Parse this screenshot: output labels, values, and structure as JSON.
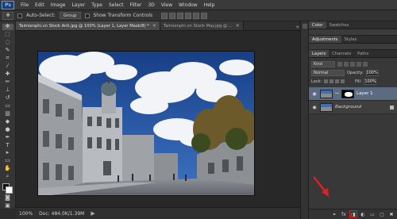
{
  "app": {
    "logo": "Ps"
  },
  "menu": [
    "File",
    "Edit",
    "Image",
    "Layer",
    "Type",
    "Select",
    "Filter",
    "3D",
    "View",
    "Window",
    "Help"
  ],
  "options": {
    "auto_select_label": "Auto-Select:",
    "auto_select_value": "Group",
    "show_transform_label": "Show Transform Controls"
  },
  "tabs": [
    {
      "label": "Taimienphi.vn Stock Anh.jpg @ 100% (Layer 1, Layer Mask/8) *",
      "close": "×"
    },
    {
      "label": "Taimienphi.vn Stock May.jpg @ ...",
      "close": "×"
    }
  ],
  "tabs_overflow": "»",
  "status": {
    "zoom": "100%",
    "doc": "Doc: 484.0K/1.39M",
    "arrow": "▶"
  },
  "panel": {
    "top_tabs": [
      "Color",
      "Swatches"
    ],
    "mid_tabs": [
      "Adjustments",
      "Styles"
    ],
    "layer_tabs": [
      "Layers",
      "Channels",
      "Paths"
    ],
    "kind_label": "Kind",
    "blend_mode": "Normal",
    "opacity_label": "Opacity:",
    "opacity_value": "100%",
    "lock_label": "Lock:",
    "fill_label": "Fill:",
    "fill_value": "100%",
    "layers": [
      {
        "name": "Layer 1",
        "selected": true
      },
      {
        "name": "Background",
        "selected": false
      }
    ]
  },
  "icons": {
    "footer": [
      "link-icon",
      "fx-icon",
      "add-mask-icon",
      "adjustment-icon",
      "folder-icon",
      "new-layer-icon",
      "trash-icon"
    ]
  },
  "colors": {
    "selected_layer": "#5a6b82",
    "highlight": "#e02020",
    "accent": "#5aa3e8"
  }
}
